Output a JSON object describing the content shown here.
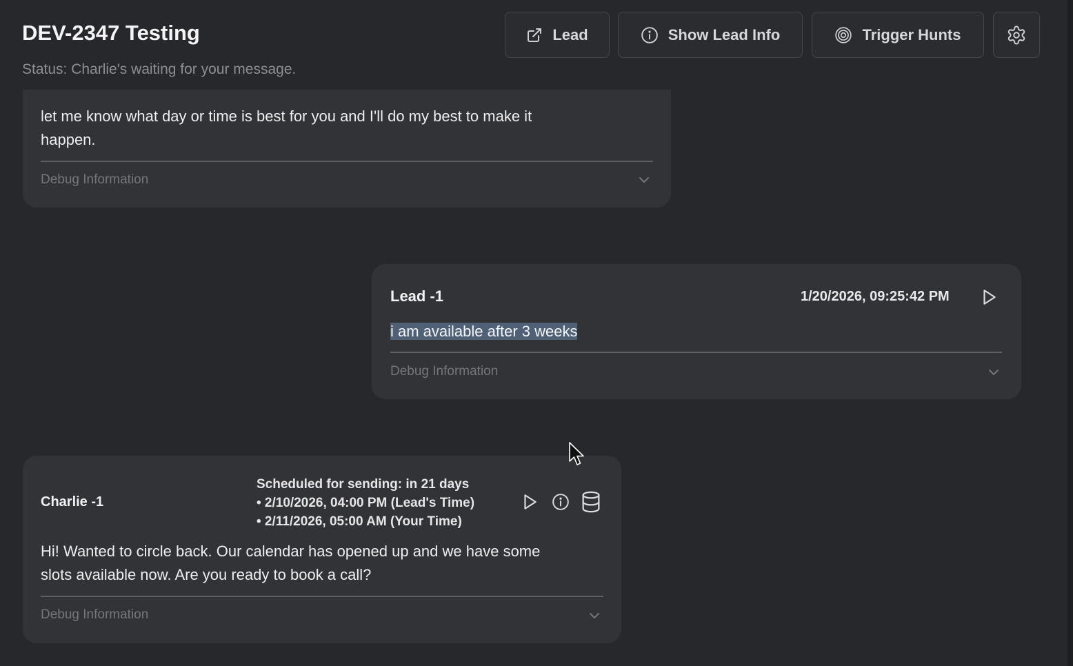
{
  "header": {
    "title": "DEV-2347 Testing",
    "status": "Status: Charlie's waiting for your message."
  },
  "toolbar": {
    "lead_label": "Lead",
    "lead_icon": "external-link-icon",
    "show_lead_info_label": "Show Lead Info",
    "show_lead_info_icon": "info-icon",
    "trigger_hunts_label": "Trigger Hunts",
    "trigger_hunts_icon": "target-icon",
    "settings_icon": "gear-icon"
  },
  "messages": [
    {
      "text_line1": "let me know what day or time is best for you and I'll do my best to make it",
      "text_line2": "happen.",
      "debug_label": "Debug Information"
    },
    {
      "sender": "Lead -1",
      "timestamp": "1/20/2026, 09:25:42 PM",
      "text": "i am available after 3 weeks",
      "debug_label": "Debug Information"
    },
    {
      "sender": "Charlie -1",
      "schedule_heading": "Scheduled for sending: in 21 days",
      "schedule_lead_time": "• 2/10/2026, 04:00 PM (Lead's Time)",
      "schedule_your_time": "• 2/11/2026, 05:00 AM (Your Time)",
      "text_line1": "Hi! Wanted to circle back. Our calendar has opened up and we have some",
      "text_line2": "slots available now. Are you ready to book a call?",
      "debug_label": "Debug Information"
    }
  ],
  "colors": {
    "background": "#27282b",
    "card": "#323337",
    "selection_highlight": "#4f6077",
    "muted_text": "#8d8e93"
  }
}
